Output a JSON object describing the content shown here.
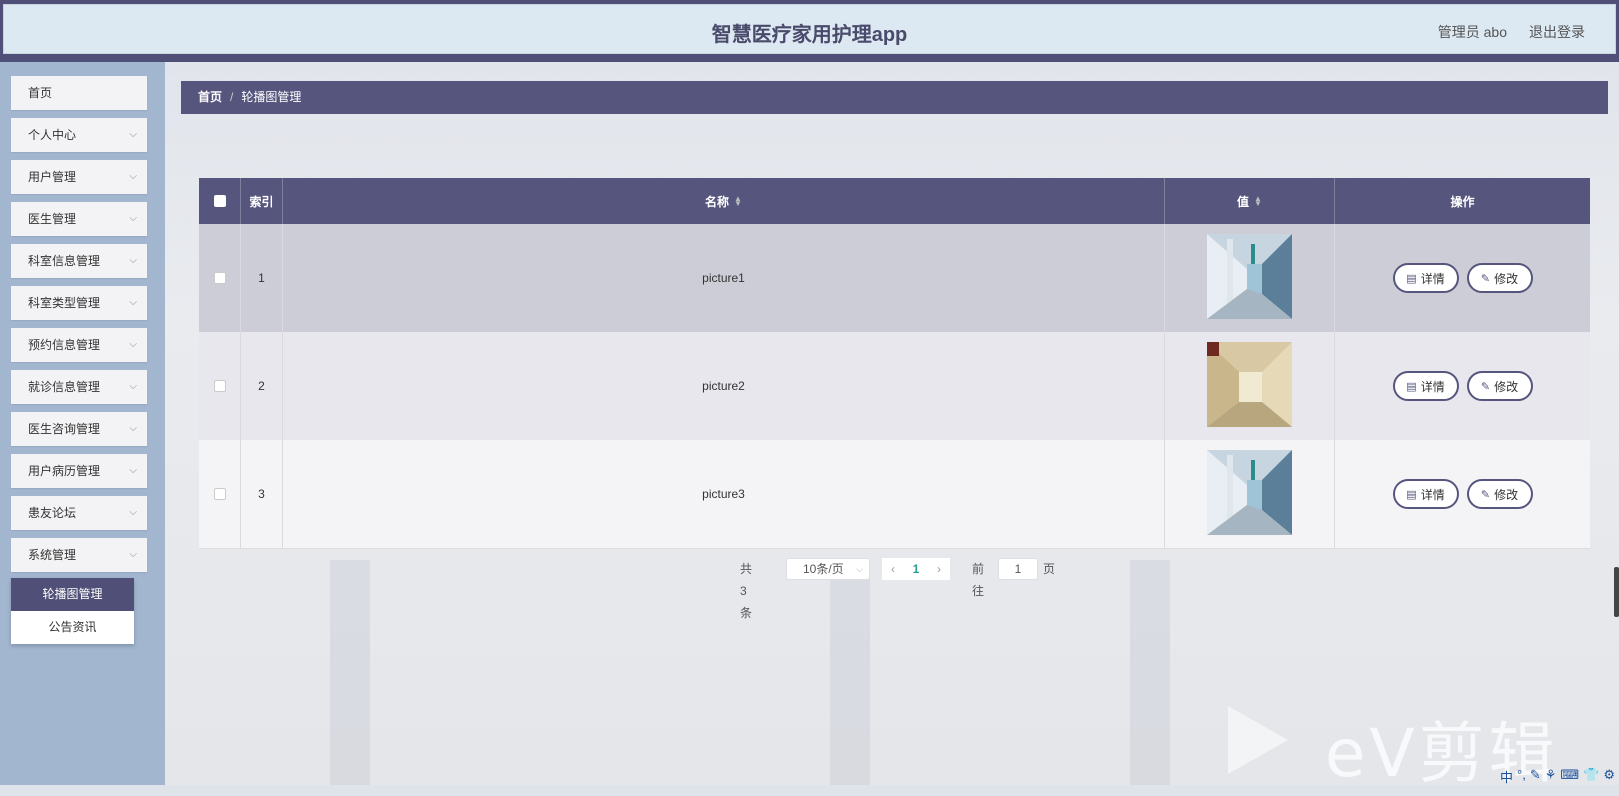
{
  "header": {
    "title": "智慧医疗家用护理app",
    "user": "管理员 abo",
    "logout": "退出登录"
  },
  "sidebar": {
    "items": [
      {
        "label": "首页",
        "expandable": false
      },
      {
        "label": "个人中心",
        "expandable": true
      },
      {
        "label": "用户管理",
        "expandable": true
      },
      {
        "label": "医生管理",
        "expandable": true
      },
      {
        "label": "科室信息管理",
        "expandable": true
      },
      {
        "label": "科室类型管理",
        "expandable": true
      },
      {
        "label": "预约信息管理",
        "expandable": true
      },
      {
        "label": "就诊信息管理",
        "expandable": true
      },
      {
        "label": "医生咨询管理",
        "expandable": true
      },
      {
        "label": "用户病历管理",
        "expandable": true
      },
      {
        "label": "患友论坛",
        "expandable": true
      },
      {
        "label": "系统管理",
        "expandable": true
      }
    ],
    "submenu": [
      {
        "label": "轮播图管理",
        "active": true
      },
      {
        "label": "公告资讯",
        "active": false
      }
    ]
  },
  "breadcrumb": {
    "home": "首页",
    "separator": "/",
    "current": "轮播图管理"
  },
  "table": {
    "headers": {
      "index": "索引",
      "name": "名称",
      "value": "值",
      "actions": "操作"
    },
    "rows": [
      {
        "index": "1",
        "name": "picture1",
        "image": "hospital-corridor-blue"
      },
      {
        "index": "2",
        "name": "picture2",
        "image": "hospital-corridor-beige"
      },
      {
        "index": "3",
        "name": "picture3",
        "image": "hospital-corridor-blue"
      }
    ],
    "detail_label": "详情",
    "edit_label": "修改"
  },
  "pagination": {
    "total": "共 3 条",
    "page_size": "10条/页",
    "current_page": "1",
    "goto_label": "前往",
    "goto_value": "1",
    "page_suffix": "页"
  },
  "watermark": "ev剪辑",
  "colors": {
    "primary": "#55557e",
    "sidebar_bg": "#a2b6d0",
    "header_bg": "#dce9f2"
  }
}
